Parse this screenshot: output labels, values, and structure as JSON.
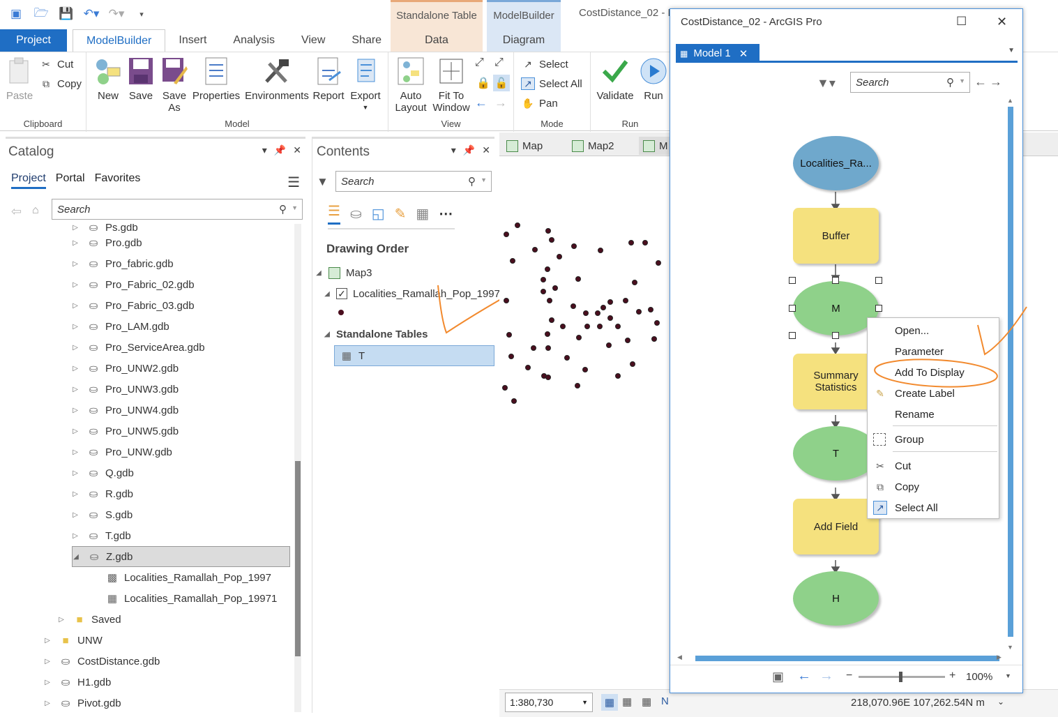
{
  "qat": {
    "icons": [
      "new-project-icon",
      "open-project-icon",
      "save-project-icon",
      "undo-icon",
      "redo-icon",
      "customize-icon"
    ]
  },
  "context_tabs": {
    "standalone_table": {
      "header": "Standalone Table",
      "tab": "Data"
    },
    "modelbuilder": {
      "header": "ModelBuilder",
      "tab": "Diagram"
    },
    "bg_title": "CostDistance_02 - M"
  },
  "tabs": {
    "project": "Project",
    "modelbuilder": "ModelBuilder",
    "insert": "Insert",
    "analysis": "Analysis",
    "view": "View",
    "share": "Share"
  },
  "ribbon": {
    "clipboard": {
      "label": "Clipboard",
      "paste": "Paste",
      "cut": "Cut",
      "copy": "Copy"
    },
    "model": {
      "label": "Model",
      "new": "New",
      "save": "Save",
      "save_as_1": "Save",
      "save_as_2": "As",
      "properties": "Properties",
      "environments": "Environments",
      "report": "Report",
      "export": "Export"
    },
    "view": {
      "label": "View",
      "auto_layout_1": "Auto",
      "auto_layout_2": "Layout",
      "fit_1": "Fit To",
      "fit_2": "Window"
    },
    "mode": {
      "label": "Mode",
      "select": "Select",
      "select_all": "Select All",
      "pan": "Pan"
    },
    "run": {
      "label": "Run",
      "validate": "Validate",
      "run": "Run"
    }
  },
  "catalog": {
    "title": "Catalog",
    "tabs": {
      "project": "Project",
      "portal": "Portal",
      "favorites": "Favorites"
    },
    "search_placeholder": "Search",
    "items": [
      {
        "label": "Ps.gdb"
      },
      {
        "label": "Pro.gdb"
      },
      {
        "label": "Pro_fabric.gdb"
      },
      {
        "label": "Pro_Fabric_02.gdb"
      },
      {
        "label": "Pro_Fabric_03.gdb"
      },
      {
        "label": "Pro_LAM.gdb"
      },
      {
        "label": "Pro_ServiceArea.gdb"
      },
      {
        "label": "Pro_UNW2.gdb"
      },
      {
        "label": "Pro_UNW3.gdb"
      },
      {
        "label": "Pro_UNW4.gdb"
      },
      {
        "label": "Pro_UNW5.gdb"
      },
      {
        "label": "Pro_UNW.gdb"
      },
      {
        "label": "Q.gdb"
      },
      {
        "label": "R.gdb"
      },
      {
        "label": "S.gdb"
      },
      {
        "label": "T.gdb"
      },
      {
        "label": "Z.gdb"
      },
      {
        "label": "Localities_Ramallah_Pop_1997"
      },
      {
        "label": "Localities_Ramallah_Pop_19971"
      },
      {
        "label": "Saved"
      },
      {
        "label": "UNW"
      },
      {
        "label": "CostDistance.gdb"
      },
      {
        "label": "H1.gdb"
      },
      {
        "label": "Pivot.gdb"
      }
    ]
  },
  "contents": {
    "title": "Contents",
    "search_placeholder": "Search",
    "drawing_order": "Drawing Order",
    "map": "Map3",
    "layer": "Localities_Ramallah_Pop_1997",
    "standalone_tables": "Standalone Tables",
    "table": "T"
  },
  "map": {
    "tabs": [
      "Map",
      "Map2",
      "M"
    ],
    "scale": "1:380,730",
    "coords": "218,070.96E 107,262.54N m"
  },
  "modelwin": {
    "title": "CostDistance_02 - ArcGIS Pro",
    "tab": "Model 1",
    "search_placeholder": "Search",
    "zoom": "100%",
    "nodes": {
      "input": "Localities_Ra...",
      "buffer": "Buffer",
      "m": "M",
      "summary_1": "Summary",
      "summary_2": "Statistics",
      "t": "T",
      "add_field": "Add Field",
      "h": "H"
    }
  },
  "context_menu": {
    "open": "Open...",
    "parameter": "Parameter",
    "add_to_display": "Add To Display",
    "create_label": "Create Label",
    "rename": "Rename",
    "group": "Group",
    "cut": "Cut",
    "copy": "Copy",
    "select_all": "Select All"
  },
  "colors": {
    "accent": "#1f6ec4",
    "annotation": "#f28a2e",
    "input_node": "#6fa8cc",
    "tool_node": "#f5e17e",
    "output_node": "#8fd18a"
  }
}
